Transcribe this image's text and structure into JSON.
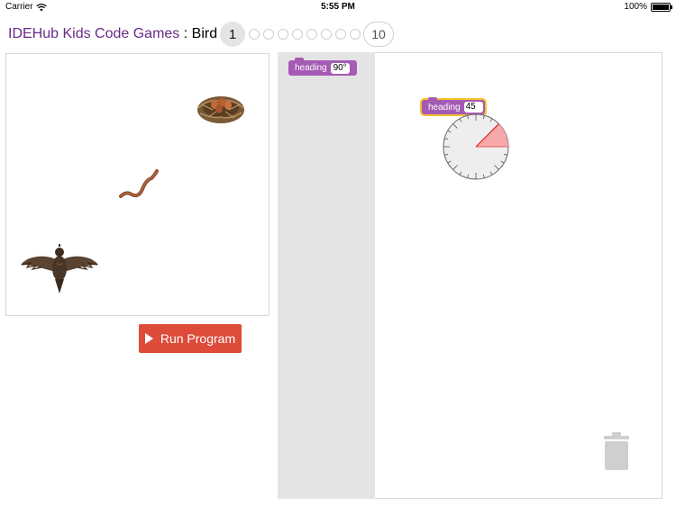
{
  "status_bar": {
    "carrier": "Carrier",
    "time": "5:55 PM",
    "battery": "100%",
    "battery_level": 1.0
  },
  "header": {
    "title": "IDEHub Kids Code Games",
    "separator": " : ",
    "game_name": "Bird",
    "levels": {
      "current": "1",
      "last": "10"
    }
  },
  "run_button": {
    "label": "Run Program"
  },
  "toolbox": {
    "heading_block": {
      "label": "heading",
      "value": "90°"
    }
  },
  "workspace": {
    "heading_block": {
      "label": "heading",
      "value": "45",
      "angle_degrees": 45
    }
  },
  "colors": {
    "title": "#6a2a86",
    "run_button": "#dd4b39",
    "block": "#a55bb5",
    "block_highlight": "#f4c12a",
    "toolbox_bg": "#e4e4e4"
  }
}
